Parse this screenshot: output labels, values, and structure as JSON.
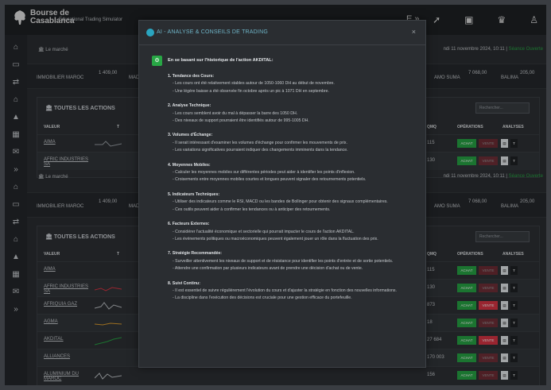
{
  "brand": {
    "name_line1": "Bourse de",
    "name_line2": "Casablanca",
    "subtitle": "Educational Trading Simulator"
  },
  "header": {
    "me_label": "E",
    "icons": [
      "arrows-icon",
      "rocket-icon",
      "chip-icon",
      "team-icon",
      "user-icon"
    ]
  },
  "breadcrumb": "Le marché",
  "date_line": {
    "text": "ndi 11 novembre 2024, 10:11 |",
    "status": "Séance Ouverte"
  },
  "ticker": {
    "left_label": "IMMOBILIER MAROC",
    "left_value": "1 409,00",
    "mid_label": "MADI",
    "right1_label": "AMO SUMA",
    "right1_value": "7 068,00",
    "right2_label": "BALIMA",
    "right2_value": "205,00"
  },
  "panel": {
    "title": "TOUTES LES ACTIONS",
    "search_placeholder": "Rechercher...",
    "columns": {
      "valeur": "VALEUR",
      "t": "T",
      "qmq": "QMQ",
      "operations": "OPÉRATIONS",
      "analyses": "ANALYSES"
    }
  },
  "buttons": {
    "buy": "ACHAT",
    "sell": "VENTE"
  },
  "stocks": [
    {
      "name": "AIMA",
      "qmq": "115"
    },
    {
      "name": "AFRIC INDUSTRIES SA",
      "qmq": "130"
    },
    {
      "name": "AFRIQUIA GAZ",
      "qmq": "873"
    },
    {
      "name": "AGMA",
      "qmq": "18"
    },
    {
      "name": "AKDITAL",
      "qmq": "27 684"
    },
    {
      "name": "ALLIANCES",
      "qmq": "170 003"
    },
    {
      "name": "ALUMINIUM DU MAROC",
      "qmq": "156"
    }
  ],
  "modal": {
    "title": "AI - ANALYSE & CONSEILS DE TRADING",
    "close": "×",
    "intro": "En se basant sur l'historique de l'action AKDITAL:",
    "sections": [
      {
        "h": "1. Tendance des Cours:",
        "lines": [
          "- Les cours ont été relativement stables autour de 1050-1060 DH au début de novembre.",
          "- Une légère baisse a été observée fin octobre après un pic à 1071 DH en septembre."
        ]
      },
      {
        "h": "2. Analyse Technique:",
        "lines": [
          "- Les cours semblent avoir du mal à dépasser la barre des 1050 DH.",
          "- Des niveaux de support pourraient être identifiés autour de 995-1005 DH."
        ]
      },
      {
        "h": "3. Volumes d'Échange:",
        "lines": [
          "- Il serait intéressant d'examiner les volumes d'échange pour confirmer les mouvements de prix.",
          "- Les variations significatives pourraient indiquer des changements imminents dans la tendance."
        ]
      },
      {
        "h": "4. Moyennes Mobiles:",
        "lines": [
          "- Calculer les moyennes mobiles sur différentes périodes peut aider à identifier les points d'inflexion.",
          "- Croisements entre moyennes mobiles courtes et longues peuvent signaler des retournements potentiels."
        ]
      },
      {
        "h": "5. Indicateurs Techniques:",
        "lines": [
          "- Utiliser des indicateurs comme le RSI, MACD ou les bandes de Bollinger pour obtenir des signaux complémentaires.",
          "- Ces outils peuvent aider à confirmer les tendances ou à anticiper des retournements."
        ]
      },
      {
        "h": "6. Facteurs Externes:",
        "lines": [
          "- Considérer l'actualité économique et sectorielle qui pourrait impacter le cours de l'action AKDITAL.",
          "- Les événements politiques ou macroéconomiques peuvent également jouer un rôle dans la fluctuation des prix."
        ]
      },
      {
        "h": "7. Stratégie Recommandée:",
        "lines": [
          "- Surveiller attentivement les niveaux de support et de résistance pour identifier les points d'entrée et de sortie potentiels.",
          "- Attendre une confirmation par plusieurs indicateurs avant de prendre une décision d'achat ou de vente."
        ]
      },
      {
        "h": "8. Suivi Continu:",
        "lines": [
          "- Il est essentiel de suivre régulièrement l'évolution du cours et d'ajuster la stratégie en fonction des nouvelles informations.",
          "- La discipline dans l'exécution des décisions est cruciale pour une gestion efficace du portefeuille."
        ]
      }
    ]
  }
}
